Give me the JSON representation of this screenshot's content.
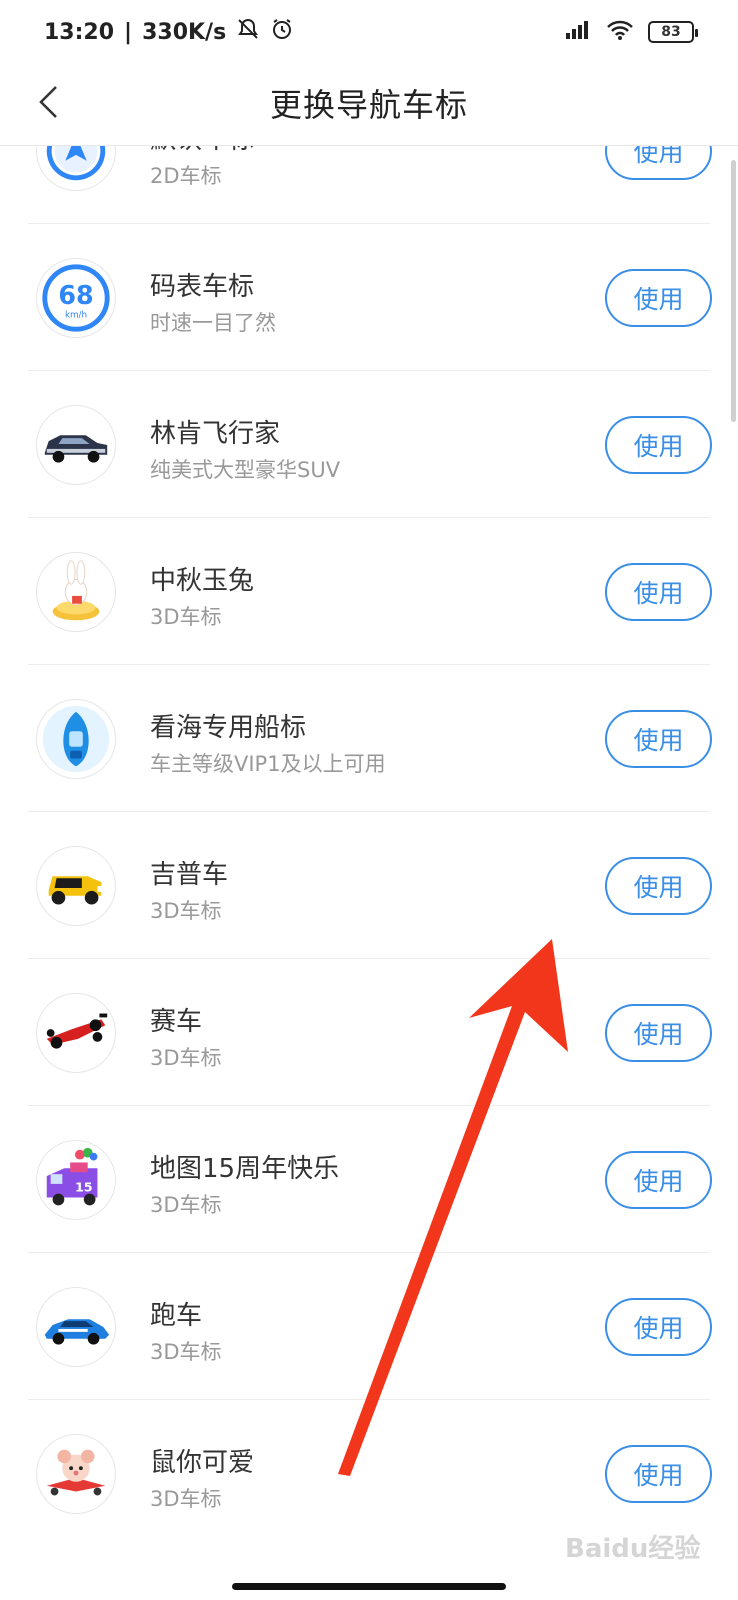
{
  "status_bar": {
    "time": "13:20",
    "speed": "330K/s",
    "battery": "83"
  },
  "header": {
    "title": "更换导航车标"
  },
  "items": [
    {
      "title": "默认车标",
      "subtitle": "2D车标",
      "button": "使用",
      "icon": "navigation-arrow-icon"
    },
    {
      "title": "码表车标",
      "subtitle": "时速一目了然",
      "button": "使用",
      "icon": "speedometer-icon",
      "speed_value": "68",
      "speed_unit": "km/h"
    },
    {
      "title": "林肯飞行家",
      "subtitle": "纯美式大型豪华SUV",
      "button": "使用",
      "icon": "suv-car-icon"
    },
    {
      "title": "中秋玉兔",
      "subtitle": "3D车标",
      "button": "使用",
      "icon": "jade-rabbit-icon"
    },
    {
      "title": "看海专用船标",
      "subtitle": "车主等级VIP1及以上可用",
      "button": "使用",
      "icon": "boat-icon"
    },
    {
      "title": "吉普车",
      "subtitle": "3D车标",
      "button": "使用",
      "icon": "jeep-icon"
    },
    {
      "title": "赛车",
      "subtitle": "3D车标",
      "button": "使用",
      "icon": "race-car-icon"
    },
    {
      "title": "地图15周年快乐",
      "subtitle": "3D车标",
      "button": "使用",
      "icon": "anniversary-van-icon",
      "badge": "15"
    },
    {
      "title": "跑车",
      "subtitle": "3D车标",
      "button": "使用",
      "icon": "sports-car-icon"
    },
    {
      "title": "鼠你可爱",
      "subtitle": "3D车标",
      "button": "使用",
      "icon": "mouse-plane-icon"
    }
  ],
  "watermark": "Baidu经验",
  "colors": {
    "accent": "#3a8ee6",
    "annotation_arrow": "#f2361b"
  }
}
